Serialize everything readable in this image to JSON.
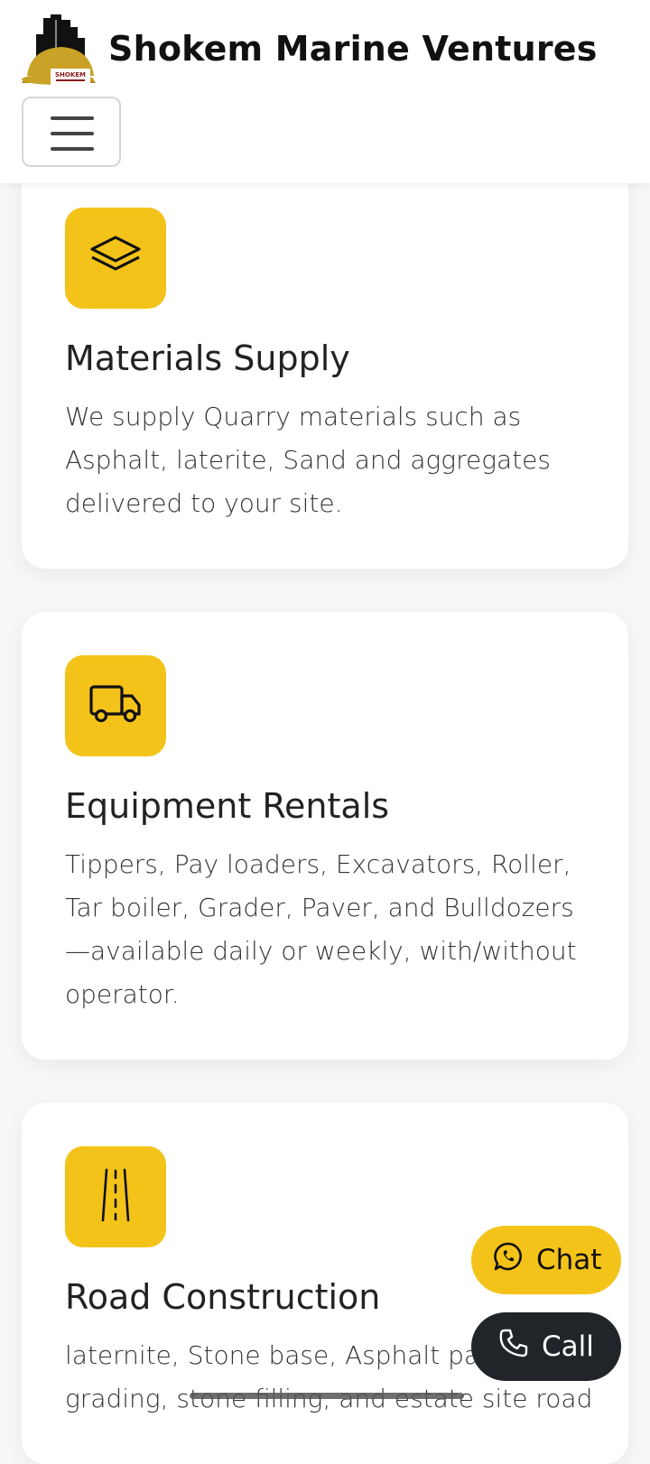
{
  "header": {
    "brand_name": "Shokem Marine Ventures",
    "logo_text": "SHOKEM",
    "logo_icon": "building-hardhat-logo",
    "menu_icon": "hamburger-menu-icon"
  },
  "colors": {
    "accent": "#f4c319",
    "dark": "#212529",
    "text": "#333333",
    "background": "#f7f7f8"
  },
  "services": [
    {
      "icon": "layers-icon",
      "title": "Materials Supply",
      "description": "We supply Quarry materials such as Asphalt, laterite, Sand and aggregates delivered to your site."
    },
    {
      "icon": "truck-icon",
      "title": "Equipment Rentals",
      "description": "Tippers, Pay loaders, Excavators, Roller, Tar boiler, Grader, Paver, and Bulldozers—available daily or weekly, with/without operator."
    },
    {
      "icon": "road-icon",
      "title": "Road Construction",
      "description": "laternite, Stone base, Asphalt pa… grading, stone filling, and estate site road"
    }
  ],
  "actions": {
    "chat_label": "Chat",
    "call_label": "Call",
    "chat_icon": "whatsapp-icon",
    "call_icon": "phone-icon"
  }
}
